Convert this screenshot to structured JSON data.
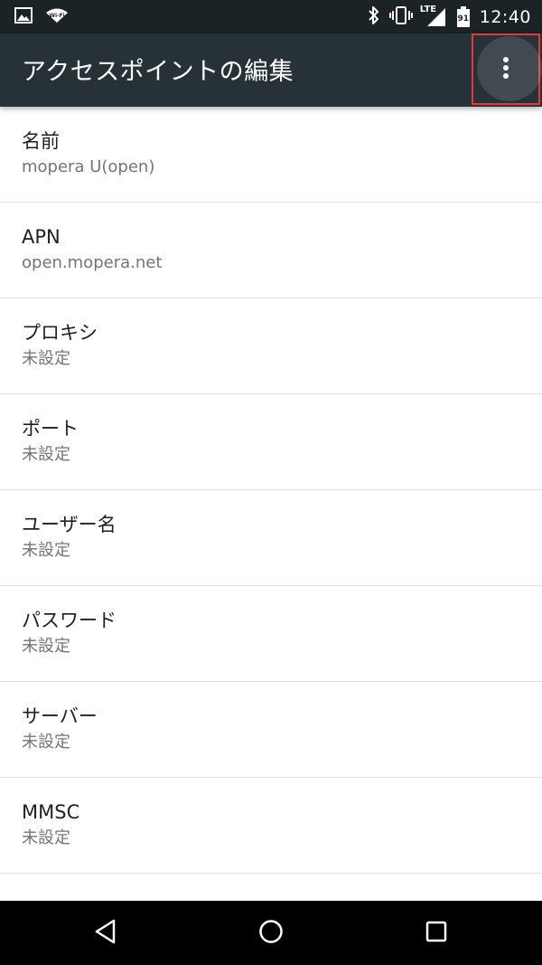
{
  "status_bar": {
    "time": "12:40",
    "network_label": "LTE",
    "battery_level": "91",
    "wifi_label": "Wi-Fi",
    "icons": [
      "image-icon",
      "wifi-icon",
      "bluetooth-icon",
      "vibrate-icon",
      "signal-icon",
      "battery-icon"
    ]
  },
  "app_bar": {
    "title": "アクセスポイントの編集",
    "overflow_icon": "more-vert-icon"
  },
  "settings": [
    {
      "title": "名前",
      "summary": "mopera U(open)"
    },
    {
      "title": "APN",
      "summary": "open.mopera.net"
    },
    {
      "title": "プロキシ",
      "summary": "未設定"
    },
    {
      "title": "ポート",
      "summary": "未設定"
    },
    {
      "title": "ユーザー名",
      "summary": "未設定"
    },
    {
      "title": "パスワード",
      "summary": "未設定"
    },
    {
      "title": "サーバー",
      "summary": "未設定"
    },
    {
      "title": "MMSC",
      "summary": "未設定"
    }
  ],
  "nav_bar": {
    "icons": [
      "back-icon",
      "home-icon",
      "recents-icon"
    ]
  },
  "colors": {
    "status_bar": "#1b2327",
    "app_bar": "#263238",
    "highlight": "#e53935"
  }
}
